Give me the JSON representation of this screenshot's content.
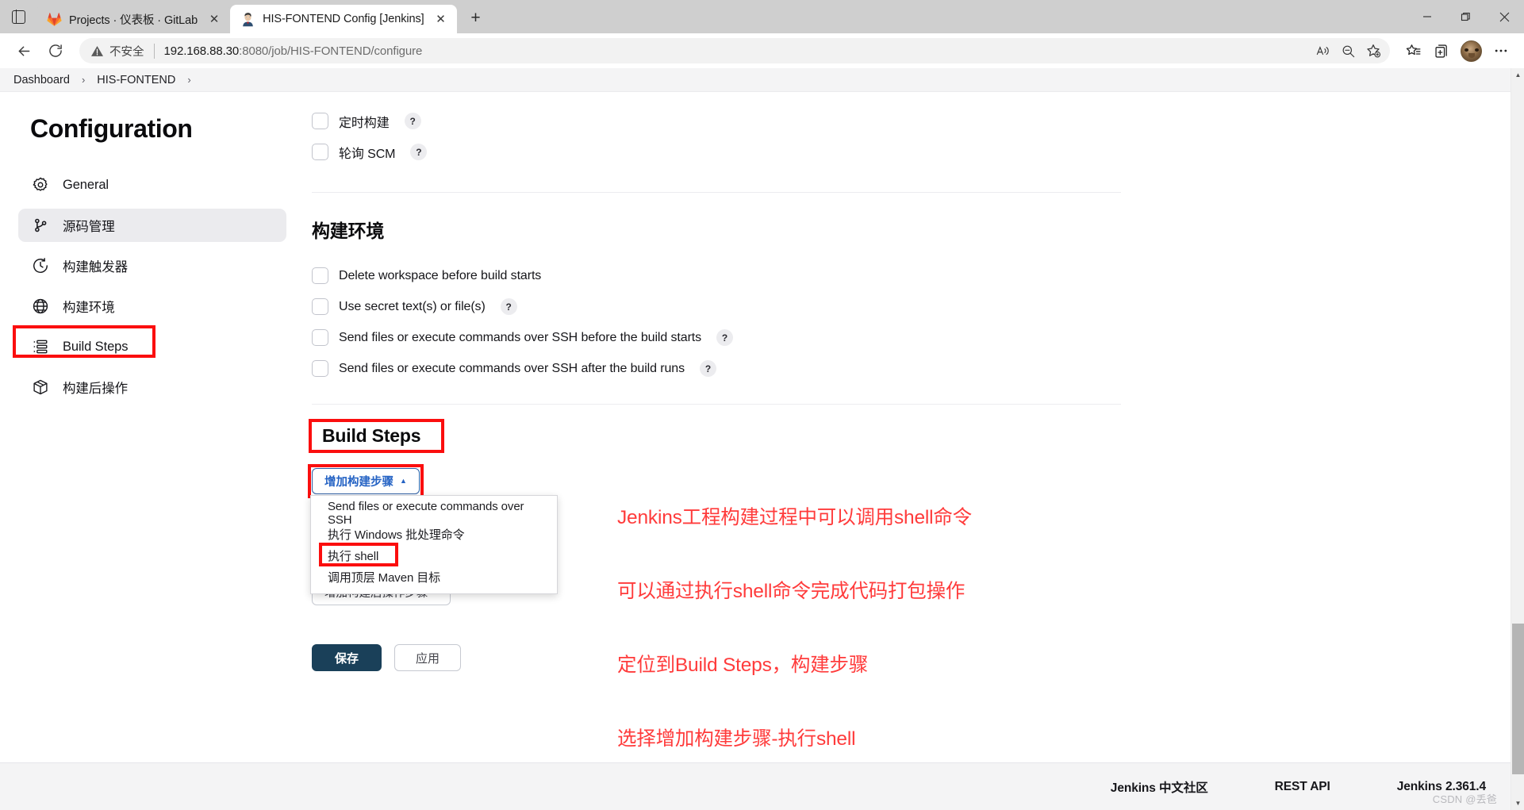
{
  "browser": {
    "tabs": [
      {
        "title": "Projects · 仪表板 · GitLab",
        "favicon": "gitlab-icon",
        "active": false
      },
      {
        "title": "HIS-FONTEND Config [Jenkins]",
        "favicon": "jenkins-icon",
        "active": true
      }
    ],
    "new_tab_label": "+",
    "close_label": "✕",
    "nav": {
      "back_icon": "back-arrow-icon",
      "reload_icon": "reload-icon",
      "security_warning": "不安全",
      "url_host": "192.168.88.30",
      "url_rest": ":8080/job/HIS-FONTEND/configure"
    },
    "omnibox_actions": [
      "read-aloud-icon",
      "zoom-out-icon",
      "add-favorite-icon"
    ],
    "toolbar_actions": [
      "favorites-icon",
      "collections-icon",
      "profile-avatar",
      "settings-more-icon"
    ],
    "window_controls": [
      "minimize",
      "restore",
      "close"
    ]
  },
  "breadcrumb": {
    "items": [
      "Dashboard",
      "HIS-FONTEND"
    ],
    "separator": "›",
    "trailing_separator": "›"
  },
  "sidebar": {
    "title": "Configuration",
    "items": [
      {
        "label": "General",
        "icon": "gear-icon",
        "selected": false,
        "highlighted": false
      },
      {
        "label": "源码管理",
        "icon": "git-branch-icon",
        "selected": true,
        "highlighted": false
      },
      {
        "label": "构建触发器",
        "icon": "clock-icon",
        "selected": false,
        "highlighted": false
      },
      {
        "label": "构建环境",
        "icon": "globe-icon",
        "selected": false,
        "highlighted": false
      },
      {
        "label": "Build Steps",
        "icon": "list-steps-icon",
        "selected": false,
        "highlighted": true
      },
      {
        "label": "构建后操作",
        "icon": "package-icon",
        "selected": false,
        "highlighted": false
      }
    ]
  },
  "main": {
    "trigger_checkboxes": [
      {
        "label": "定时构建",
        "help": "?",
        "checked": false
      },
      {
        "label": "轮询 SCM",
        "help": "?",
        "checked": false
      }
    ],
    "build_env": {
      "title": "构建环境",
      "checkboxes": [
        {
          "label": "Delete workspace before build starts",
          "help": null,
          "checked": false
        },
        {
          "label": "Use secret text(s) or file(s)",
          "help": "?",
          "checked": false
        },
        {
          "label": "Send files or execute commands over SSH before the build starts",
          "help": "?",
          "checked": false
        },
        {
          "label": "Send files or execute commands over SSH after the build runs",
          "help": "?",
          "checked": false
        }
      ]
    },
    "build_steps": {
      "title": "Build Steps",
      "add_button": "增加构建步骤",
      "add_button_caret": "▲",
      "menu_items": [
        {
          "label": "Send files or execute commands over SSH",
          "highlighted": false
        },
        {
          "label": "执行 Windows 批处理命令",
          "highlighted": false
        },
        {
          "label": "执行 shell",
          "highlighted": true
        },
        {
          "label": "调用顶层 Maven 目标",
          "highlighted": false
        }
      ]
    },
    "post_build": {
      "add_button": "增加构建后操作步骤",
      "add_button_caret": "▾"
    },
    "actions": {
      "save": "保存",
      "apply": "应用"
    }
  },
  "annotation": {
    "color": "#ff3b3b",
    "lines": [
      "Jenkins工程构建过程中可以调用shell命令",
      "可以通过执行shell命令完成代码打包操作",
      "定位到Build Steps，构建步骤",
      "选择增加构建步骤-执行shell"
    ]
  },
  "footer": {
    "links": [
      "Jenkins 中文社区",
      "REST API",
      "Jenkins 2.361.4"
    ],
    "watermark": "CSDN @丢爸"
  },
  "colors": {
    "highlight_red": "#fb0e0e",
    "annotation_red": "#ff3b3b",
    "save_button": "#1a4059",
    "link_blue": "#2563c4",
    "selected_nav_bg": "#ebebee"
  }
}
